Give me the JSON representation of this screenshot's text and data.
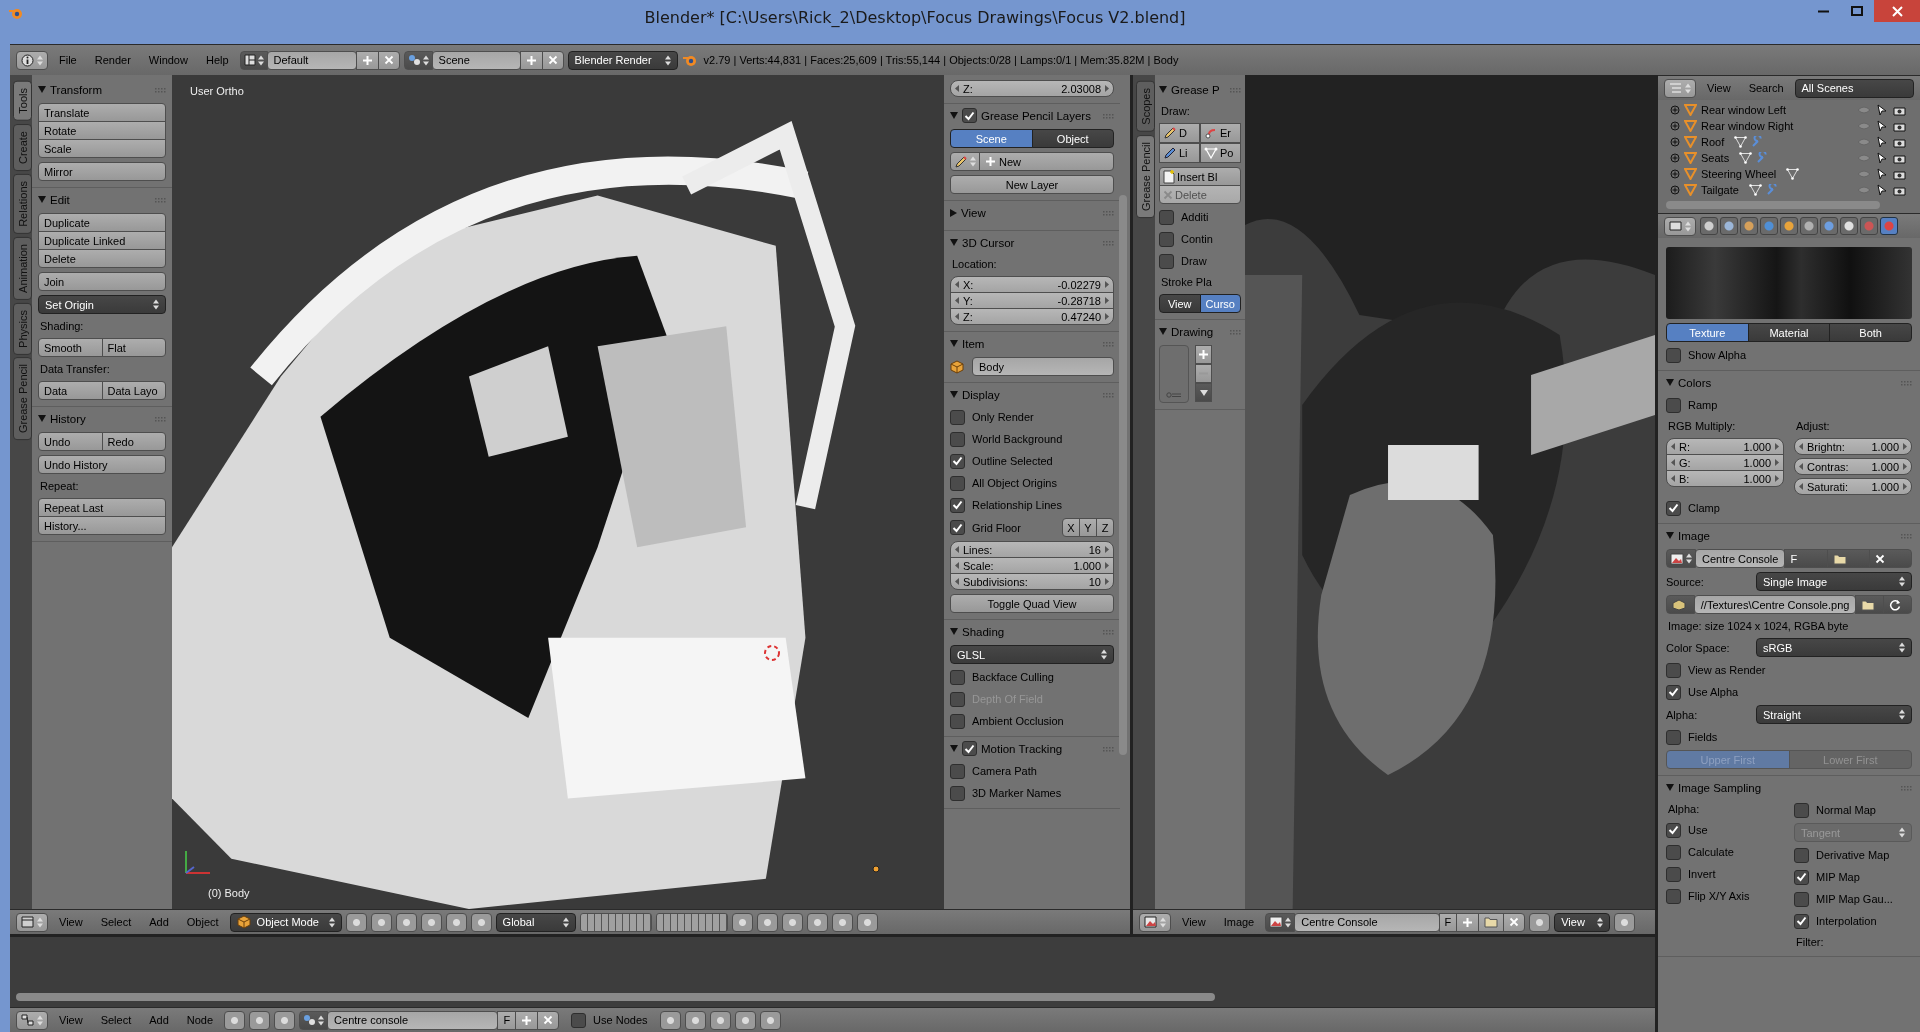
{
  "window": {
    "title": "Blender* [C:\\Users\\Rick_2\\Desktop\\Focus Drawings\\Focus V2.blend]"
  },
  "info_header": {
    "menus": [
      "File",
      "Render",
      "Window",
      "Help"
    ],
    "layout": "Default",
    "scene": "Scene",
    "engine": "Blender Render",
    "stats": "v2.79 | Verts:44,831 | Faces:25,609 | Tris:55,144 | Objects:0/28 | Lamps:0/1 | Mem:35.82M | Body"
  },
  "tool_tabs": [
    {
      "label": "Tools",
      "selected": true
    },
    {
      "label": "Create",
      "selected": false
    },
    {
      "label": "Relations",
      "selected": false
    },
    {
      "label": "Animation",
      "selected": false
    },
    {
      "label": "Physics",
      "selected": false
    },
    {
      "label": "Grease Pencil",
      "selected": false
    }
  ],
  "tool_panels": [
    {
      "title": "Transform",
      "expanded": true,
      "rows": [
        {
          "kind": "stack",
          "items": [
            "Translate",
            "Rotate",
            "Scale"
          ]
        },
        {
          "kind": "button",
          "text": "Mirror",
          "center": false
        }
      ]
    },
    {
      "title": "Edit",
      "expanded": true,
      "rows": [
        {
          "kind": "stack",
          "items": [
            "Duplicate",
            "Duplicate Linked",
            "Delete"
          ]
        },
        {
          "kind": "button",
          "text": "Join"
        },
        {
          "kind": "dropdown",
          "text": "Set Origin",
          "disabled": false
        },
        {
          "kind": "label",
          "text": "Shading:"
        },
        {
          "kind": "row",
          "items": [
            "Smooth",
            "Flat"
          ]
        },
        {
          "kind": "label",
          "text": "Data Transfer:"
        },
        {
          "kind": "row",
          "items": [
            "Data",
            "Data Layo"
          ]
        }
      ]
    },
    {
      "title": "History",
      "expanded": true,
      "rows": [
        {
          "kind": "row",
          "items": [
            "Undo",
            "Redo"
          ]
        },
        {
          "kind": "button",
          "text": "Undo History"
        },
        {
          "kind": "label",
          "text": "Repeat:"
        },
        {
          "kind": "stack",
          "items": [
            "Repeat Last",
            "History..."
          ]
        }
      ]
    }
  ],
  "viewport": {
    "view_name": "User Ortho",
    "object_name": "(0) Body"
  },
  "sidebar_panels": [
    {
      "rows": [
        {
          "kind": "fields",
          "items": [
            {
              "label": "Z:",
              "value": "2.03008"
            }
          ]
        }
      ]
    },
    {
      "title": "Grease Pencil Layers",
      "expanded": true,
      "checked": true,
      "rows": [
        {
          "kind": "segment",
          "disabled": false,
          "items": [
            {
              "label": "Scene",
              "selected": true
            },
            {
              "label": "Object",
              "selected": false
            }
          ]
        },
        {
          "kind": "addnew",
          "text": "New"
        },
        {
          "kind": "button",
          "text": "New Layer",
          "center": true
        }
      ]
    },
    {
      "title": "View",
      "expanded": false
    },
    {
      "title": "3D Cursor",
      "expanded": true,
      "rows": [
        {
          "kind": "label",
          "text": "Location:"
        },
        {
          "kind": "fields",
          "items": [
            {
              "label": "X:",
              "value": "-0.02279"
            },
            {
              "label": "Y:",
              "value": "-0.28718"
            },
            {
              "label": "Z:",
              "value": "0.47240"
            }
          ]
        }
      ]
    },
    {
      "title": "Item",
      "expanded": true,
      "rows": [
        {
          "kind": "object",
          "text": "Body"
        }
      ]
    },
    {
      "title": "Display",
      "expanded": true,
      "rows": [
        {
          "kind": "checkbox",
          "text": "Only Render",
          "checked": false,
          "disabled": false
        },
        {
          "kind": "checkbox",
          "text": "World Background",
          "checked": false,
          "disabled": false
        },
        {
          "kind": "checkbox",
          "text": "Outline Selected",
          "checked": true,
          "disabled": false
        },
        {
          "kind": "checkbox",
          "text": "All Object Origins",
          "checked": false,
          "disabled": false
        },
        {
          "kind": "checkbox",
          "text": "Relationship Lines",
          "checked": true,
          "disabled": false
        },
        {
          "kind": "checkbox",
          "text": "Grid Floor",
          "checked": true,
          "disabled": false,
          "axes": [
            "X",
            "Y",
            "Z"
          ]
        },
        {
          "kind": "fields",
          "items": [
            {
              "label": "Lines:",
              "value": "16"
            },
            {
              "label": "Scale:",
              "value": "1.000"
            },
            {
              "label": "Subdivisions:",
              "value": "10"
            }
          ]
        },
        {
          "kind": "button",
          "text": "Toggle Quad View",
          "center": true
        }
      ]
    },
    {
      "title": "Shading",
      "expanded": true,
      "rows": [
        {
          "kind": "dropdown",
          "text": "GLSL",
          "disabled": false
        },
        {
          "kind": "checkbox",
          "text": "Backface Culling",
          "checked": false,
          "disabled": false
        },
        {
          "kind": "checkbox",
          "text": "Depth Of Field",
          "checked": false,
          "disabled": true
        },
        {
          "kind": "checkbox",
          "text": "Ambient Occlusion",
          "checked": false,
          "disabled": false
        }
      ]
    },
    {
      "title": "Motion Tracking",
      "expanded": true,
      "checked": true,
      "rows": [
        {
          "kind": "checkbox",
          "text": "Camera Path",
          "checked": false,
          "disabled": false
        },
        {
          "kind": "checkbox",
          "text": "3D Marker Names",
          "checked": false,
          "disabled": false
        }
      ]
    }
  ],
  "grease_pencil_tabs": [
    {
      "label": "Scopes",
      "selected": false
    },
    {
      "label": "Grease Pencil",
      "selected": true
    }
  ],
  "grease_pencil_panels": [
    {
      "title": "Grease P",
      "expanded": true,
      "rows": [
        {
          "kind": "label",
          "text": "Draw:"
        },
        {
          "kind": "tools",
          "items": [
            {
              "kind": "draw",
              "label": "D"
            },
            {
              "kind": "erase",
              "label": "Er"
            },
            {
              "kind": "line",
              "label": "Li"
            },
            {
              "kind": "poly",
              "label": "Po"
            }
          ]
        },
        {
          "kind": "keyframes",
          "items": [
            {
              "kind": "insert",
              "label": "Insert Bl",
              "disabled": false
            },
            {
              "kind": "delete",
              "label": "Delete",
              "disabled": true
            }
          ]
        },
        {
          "kind": "checkbox",
          "text": "Additi",
          "checked": false,
          "disabled": false
        },
        {
          "kind": "checkbox",
          "text": "Contin",
          "checked": false,
          "disabled": false
        },
        {
          "kind": "checkbox",
          "text": "Draw",
          "checked": false,
          "disabled": false
        },
        {
          "kind": "label",
          "text": "Stroke Pla"
        },
        {
          "kind": "segment",
          "disabled": false,
          "items": [
            {
              "label": "View",
              "selected": false
            },
            {
              "label": "Curso",
              "selected": true
            }
          ]
        }
      ]
    },
    {
      "title": "Drawing",
      "expanded": true,
      "rows": [
        {
          "kind": "list"
        }
      ]
    }
  ],
  "viewport_header": {
    "menus": [
      "View",
      "Select",
      "Add",
      "Object"
    ],
    "mode": "Object Mode",
    "orientation": "Global"
  },
  "image_header": {
    "menus": [
      "View",
      "Image"
    ],
    "image": "Centre Console",
    "fake_user": "F",
    "view": "View"
  },
  "node_header": {
    "menus": [
      "View",
      "Select",
      "Add",
      "Node"
    ],
    "material": "Centre console",
    "fake_user": "F",
    "use_nodes": {
      "label": "Use Nodes",
      "checked": false
    }
  },
  "outliner": {
    "menus": [
      "View",
      "Search"
    ],
    "filter": "All Scenes",
    "items": [
      {
        "name": "Rear window Left"
      },
      {
        "name": "Rear window Right"
      },
      {
        "name": "Roof",
        "data": true,
        "modifier": true
      },
      {
        "name": "Seats",
        "data": true,
        "modifier": true
      },
      {
        "name": "Steering Wheel",
        "data": true,
        "modifier": false
      },
      {
        "name": "Tailgate",
        "data": true,
        "modifier": true
      }
    ]
  },
  "properties": {
    "tabs": [
      {
        "selected": false
      },
      {
        "selected": false
      },
      {
        "selected": false
      },
      {
        "selected": false
      },
      {
        "selected": false
      },
      {
        "selected": false
      },
      {
        "selected": false
      },
      {
        "selected": false
      },
      {
        "selected": false
      },
      {
        "selected": true
      }
    ],
    "panels": [
      {
        "rows": [
          {
            "kind": "preview"
          },
          {
            "kind": "segment",
            "disabled": false,
            "items": [
              {
                "label": "Texture",
                "selected": true
              },
              {
                "label": "Material",
                "selected": false
              },
              {
                "label": "Both",
                "selected": false
              }
            ]
          },
          {
            "kind": "checkbox",
            "text": "Show Alpha",
            "checked": false,
            "disabled": false
          }
        ]
      },
      {
        "title": "Colors",
        "expanded": true,
        "rows": [
          {
            "kind": "checkbox",
            "text": "Ramp",
            "checked": false,
            "disabled": false
          },
          {
            "kind": "columns",
            "left": [
              {
                "kind": "label",
                "text": "RGB Multiply:"
              },
              {
                "kind": "fields",
                "items": [
                  {
                    "label": "R:",
                    "value": "1.000"
                  },
                  {
                    "label": "G:",
                    "value": "1.000"
                  },
                  {
                    "label": "B:",
                    "value": "1.000"
                  }
                ]
              }
            ],
            "right": [
              {
                "kind": "label",
                "text": "Adjust:"
              },
              {
                "kind": "fields",
                "round": true,
                "items": [
                  {
                    "label": "Brightn:",
                    "value": "1.000"
                  },
                  {
                    "label": "Contras:",
                    "value": "1.000"
                  },
                  {
                    "label": "Saturati:",
                    "value": "1.000"
                  }
                ]
              }
            ]
          },
          {
            "kind": "checkbox",
            "text": "Clamp",
            "checked": true,
            "disabled": false
          }
        ]
      },
      {
        "title": "Image",
        "expanded": true,
        "rows": [
          {
            "kind": "datablock",
            "text": "Centre Console",
            "fake": "F"
          },
          {
            "kind": "dropdown",
            "label": "Source:",
            "text": "Single Image",
            "disabled": false
          },
          {
            "kind": "filepath",
            "text": "//Textures\\Centre Console.png"
          },
          {
            "kind": "label",
            "text": "Image: size 1024 x 1024, RGBA byte"
          },
          {
            "kind": "dropdown",
            "label": "Color Space:",
            "text": "sRGB",
            "disabled": false
          },
          {
            "kind": "checkbox",
            "text": "View as Render",
            "checked": false,
            "disabled": false
          },
          {
            "kind": "checkbox",
            "text": "Use Alpha",
            "checked": true,
            "disabled": false
          },
          {
            "kind": "dropdown",
            "label": "Alpha:",
            "text": "Straight",
            "disabled": false
          },
          {
            "kind": "checkbox",
            "text": "Fields",
            "checked": false,
            "disabled": false
          },
          {
            "kind": "segment",
            "disabled": true,
            "items": [
              {
                "label": "Upper First",
                "selected": true
              },
              {
                "label": "Lower First",
                "selected": false
              }
            ]
          }
        ]
      },
      {
        "title": "Image Sampling",
        "expanded": true,
        "rows": [
          {
            "kind": "columns",
            "left": [
              {
                "kind": "label",
                "text": "Alpha:"
              },
              {
                "kind": "checkbox",
                "text": "Use",
                "checked": true,
                "disabled": false
              },
              {
                "kind": "checkbox",
                "text": "Calculate",
                "checked": false,
                "disabled": false
              },
              {
                "kind": "checkbox",
                "text": "Invert",
                "checked": false,
                "disabled": false
              },
              {
                "kind": "checkbox",
                "text": "Flip X/Y Axis",
                "checked": false,
                "disabled": false
              }
            ],
            "right": [
              {
                "kind": "checkbox",
                "text": "Normal Map",
                "checked": false,
                "disabled": false
              },
              {
                "kind": "dropdown",
                "text": "Tangent",
                "disabled": true
              },
              {
                "kind": "checkbox",
                "text": "Derivative Map",
                "checked": false,
                "disabled": false
              },
              {
                "kind": "checkbox",
                "text": "MIP Map",
                "checked": true,
                "disabled": false
              },
              {
                "kind": "checkbox",
                "text": "MIP Map Gau...",
                "checked": false,
                "disabled": false
              },
              {
                "kind": "checkbox",
                "text": "Interpolation",
                "checked": true,
                "disabled": false
              },
              {
                "kind": "label",
                "text": "Filter:"
              }
            ]
          }
        ]
      }
    ]
  }
}
